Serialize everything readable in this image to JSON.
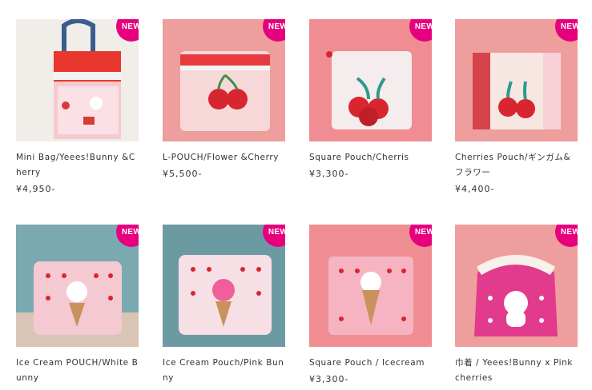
{
  "badge_label": "NEW",
  "colors": {
    "badge": "#e6007e",
    "text": "#333333",
    "photo_bg": "#f0a9a4"
  },
  "products": [
    {
      "name": "Mini Bag/Yeees!Bunny &Cherry",
      "price": "¥4,950-",
      "image": "mini-bag-bunny-cherry-photo"
    },
    {
      "name": "L-POUCH/Flower &Cherry",
      "price": "¥5,500-",
      "image": "l-pouch-flower-cherry-photo"
    },
    {
      "name": "Square Pouch/Cherris",
      "price": "¥3,300-",
      "image": "square-pouch-cherries-photo"
    },
    {
      "name": "Cherries Pouch/ギンガム&フラワー",
      "price": "¥4,400-",
      "image": "cherries-pouch-gingham-flower-photo"
    },
    {
      "name": "Ice Cream POUCH/White Bunny",
      "price": "",
      "image": "ice-cream-pouch-white-bunny-photo"
    },
    {
      "name": "Ice Cream Pouch/Pink Bunny",
      "price": "",
      "image": "ice-cream-pouch-pink-bunny-photo"
    },
    {
      "name": "Square Pouch / Icecream",
      "price": "¥3,300-",
      "image": "square-pouch-icecream-photo"
    },
    {
      "name": "巾着 / Yeees!Bunny x Pink cherries",
      "price": "",
      "image": "drawstring-bag-bunny-pink-cherries-photo"
    }
  ]
}
